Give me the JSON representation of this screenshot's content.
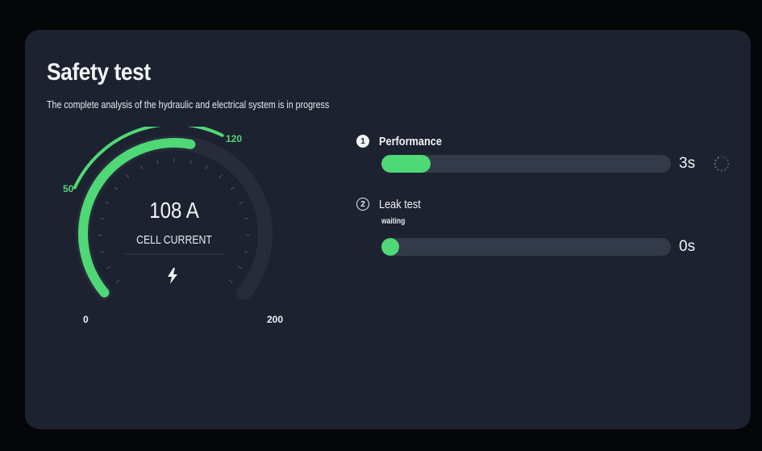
{
  "page": {
    "title": "Safety test",
    "subtitle": "The complete analysis of the hydraulic and electrical system is in progress"
  },
  "gauge": {
    "value_text": "108 A",
    "label": "CELL CURRENT",
    "value": 108,
    "min": 0,
    "max": 200,
    "min_label": "0",
    "max_label": "200",
    "range_low": 50,
    "range_high": 120,
    "range_low_label": "50",
    "range_high_label": "120",
    "icon": "lightning-bolt-icon"
  },
  "steps": [
    {
      "number": "1",
      "name": "Performance",
      "status": "",
      "progress": 0.17,
      "time": "3s",
      "state": "running"
    },
    {
      "number": "2",
      "name": "Leak test",
      "status": "waiting",
      "progress": 0,
      "time": "0s",
      "state": "waiting"
    }
  ],
  "colors": {
    "background": "#050608",
    "card": "#1d2230",
    "accent": "#4fd876",
    "track": "#333a49",
    "text": "#f1f3f6"
  }
}
